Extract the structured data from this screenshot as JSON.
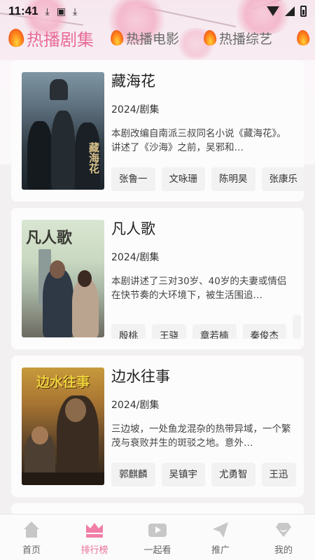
{
  "status_bar": {
    "time": "11:41"
  },
  "tabs": [
    {
      "label": "热播剧集",
      "active": true
    },
    {
      "label": "热播电影",
      "active": false
    },
    {
      "label": "热播综艺",
      "active": false
    }
  ],
  "cards": [
    {
      "title": "藏海花",
      "meta": "2024/剧集",
      "description": "本剧改编自南派三叔同名小说《藏海花》。讲述了《沙海》之前，吴邪和…",
      "poster_text": "藏海花",
      "cast": [
        "张鲁一",
        "文咏珊",
        "陈明昊",
        "张康乐"
      ]
    },
    {
      "title": "凡人歌",
      "meta": "2024/剧集",
      "description": "本剧讲述了三对30岁、40岁的夫妻或情侣在快节奏的大环境下，被生活围追…",
      "poster_text": "凡人歌",
      "cast": [
        "殷桃",
        "王骁",
        "章若楠",
        "秦俊杰"
      ]
    },
    {
      "title": "边水往事",
      "meta": "2024/剧集",
      "description": "三边坡，一处鱼龙混杂的热带异域，一个繁茂与衰败并生的斑驳之地。意外…",
      "poster_text": "边水往事",
      "cast": [
        "郭麒麟",
        "吴镇宇",
        "尤勇智",
        "王迅"
      ]
    }
  ],
  "bottom_nav": [
    {
      "label": "首页",
      "icon": "home-icon",
      "active": false
    },
    {
      "label": "排行榜",
      "icon": "crown-icon",
      "active": true
    },
    {
      "label": "一起看",
      "icon": "play-icon",
      "active": false
    },
    {
      "label": "推广",
      "icon": "paper-plane-icon",
      "active": false
    },
    {
      "label": "我的",
      "icon": "diamond-icon",
      "active": false
    }
  ],
  "colors": {
    "accent": "#e86c98",
    "background": "#f3f0f2"
  }
}
